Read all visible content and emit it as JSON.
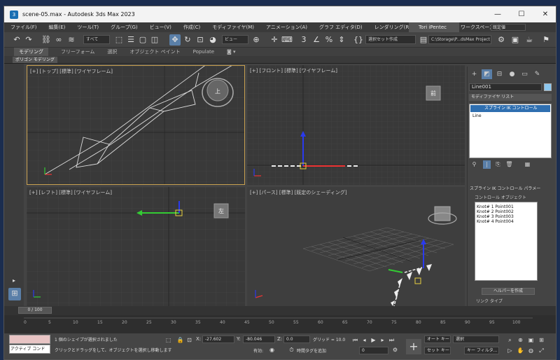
{
  "titlebar": {
    "icon": "3ds-max-icon",
    "title": "scene-05.max - Autodesk 3ds Max 2023",
    "minimize": "—",
    "maximize": "☐",
    "close": "✕"
  },
  "menu": {
    "items": [
      "ファイル(F)",
      "編集(E)",
      "ツール(T)",
      "グループ(G)",
      "ビュー(V)",
      "作成(C)",
      "モディファイヤ(M)",
      "アニメーション(A)",
      "グラフ エディタ(D)",
      "レンダリング(R)"
    ],
    "user": "Tori iPentec",
    "workspace_label": "ワークスペース:",
    "workspace_value": "既定値"
  },
  "toolbar": {
    "filter": "すべて",
    "view_dropdown": "ビュー",
    "selection_set": "選択セット作成",
    "project_path": "C:\\Storage\\P...dsMax Project"
  },
  "ribbon": {
    "tabs": [
      "モデリング",
      "フリーフォーム",
      "選択",
      "オブジェクト ペイント",
      "Populate"
    ],
    "active": "モデリング",
    "panel": "ポリゴン モデリング"
  },
  "viewports": {
    "top": "[+] [トップ] [標準] [ワイヤフレーム]",
    "front": "[+] [フロント] [標準] [ワイヤフレーム]",
    "left": "[+] [レフト] [標準] [ワイヤフレーム]",
    "persp": "[+] [パース] [標準] [既定のシェーディング]",
    "cube_top": "上",
    "cube_front": "前",
    "cube_left": "左"
  },
  "command_panel": {
    "object_name": "Line001",
    "modifier_list": "モディファイヤ リスト",
    "stack": [
      "スプライン IK コントロール",
      "Line"
    ],
    "rollout_title": "スプライン IK コントロール パラメー",
    "control_objects": "コントロール オブジェクト",
    "knots": [
      "Knot# 1 Point001",
      "Knot# 2 Point002",
      "Knot# 3 Point003",
      "Knot# 4 Point004"
    ],
    "helper_button": "ヘルパーを作成",
    "link_type": "リンク タイプ"
  },
  "timeline": {
    "slider": "0 / 100",
    "ticks": [
      "0",
      "5",
      "10",
      "15",
      "20",
      "25",
      "30",
      "35",
      "40",
      "45",
      "50",
      "55",
      "60",
      "65",
      "70",
      "75",
      "80",
      "85",
      "90",
      "95",
      "100"
    ]
  },
  "status": {
    "active": "アクティブ コンド",
    "message1": "1 個のシェイプが選択されました",
    "message2": "クリックとドラッグをして、オブジェクトを選択し移動します",
    "x": "-27.602",
    "y": "-80.046",
    "z": "0.0",
    "grid": "グリッド = 10.0",
    "enabled": "有効:",
    "add_tag": "時間タグを追加",
    "auto_key": "オート キー",
    "set_key": "セット キー",
    "selected": "選択",
    "key_filter": "キー フィルタ...",
    "frame": "0"
  },
  "colors": {
    "accent": "#5a7fa8",
    "viewport_bg": "#393939",
    "selected_border": "#c8a050"
  }
}
